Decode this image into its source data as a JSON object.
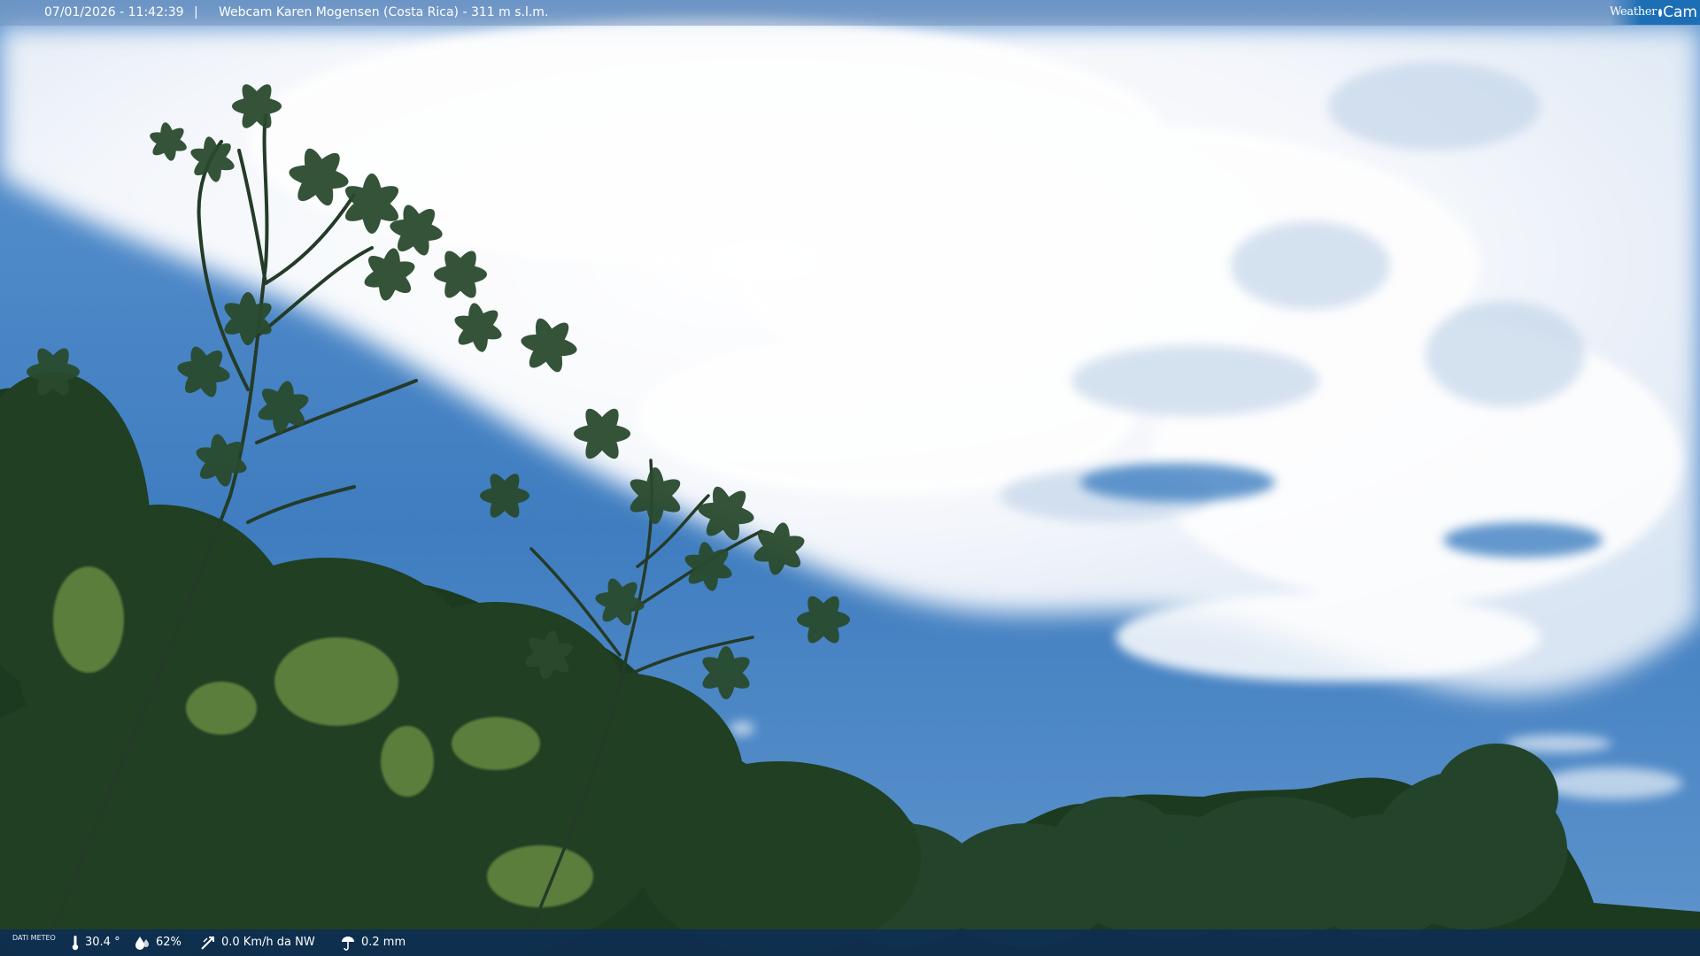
{
  "overlay": {
    "timestamp": "07/01/2026 - 11:42:39",
    "separator": "|",
    "camera_title": "Webcam Karen Mogensen (Costa Rica) - 311 m s.l.m."
  },
  "brand": {
    "part1": "Weather",
    "part2": "Cam",
    "icon": "globe-icon"
  },
  "weather": {
    "label": "DATI METEO",
    "temperature": "30.4 °",
    "humidity": "62%",
    "wind": "0.0 Km/h da NW",
    "rain": "0.2 mm",
    "icons": {
      "temperature": "thermometer-icon",
      "humidity": "humidity-drop-icon",
      "wind": "wind-icon",
      "rain": "rain-icon"
    }
  },
  "colors": {
    "sky": "#3f7dc0",
    "bottom_bar": "#0c2d55",
    "brand": "#1c6fb5"
  }
}
